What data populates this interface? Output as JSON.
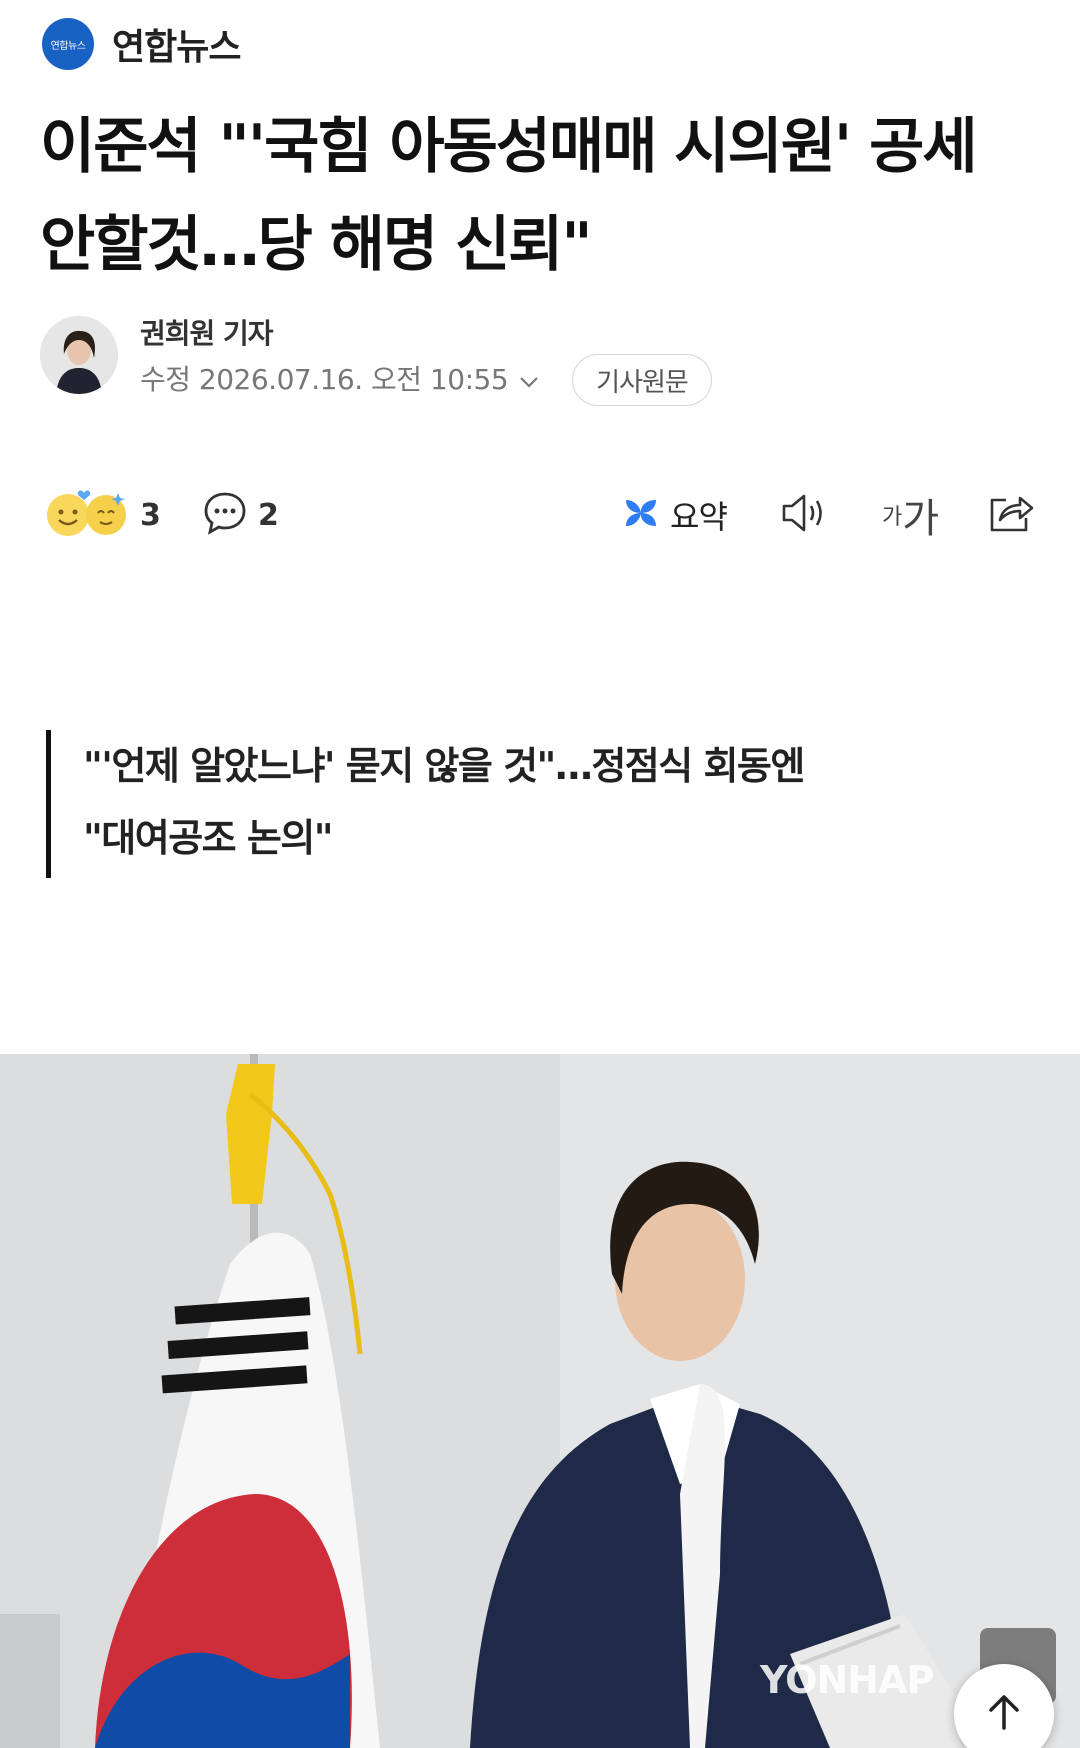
{
  "publisher": {
    "logo_text": "연합뉴스",
    "name": "연합뉴스"
  },
  "headline": "이준석 \"'국힘 아동성매매 시의원' 공세 안할것…당 해명 신뢰\"",
  "byline": {
    "reporter": "권희원 기자",
    "edited_label": "수정 2026.07.16. 오전 10:55",
    "original_button": "기사원문"
  },
  "toolbar": {
    "reaction_count": "3",
    "comment_count": "2",
    "summary_label": "요약",
    "font_small": "가",
    "font_large": "가"
  },
  "subheadline": {
    "line1": "\"'언제 알았느냐' 묻지 않을 것\"…정점식 회동엔",
    "line2": "\"대여공조 논의\""
  },
  "photo": {
    "watermark": "YONHAP"
  },
  "colors": {
    "brand": "#1762c2",
    "summary_icon": "#2f7df6"
  }
}
